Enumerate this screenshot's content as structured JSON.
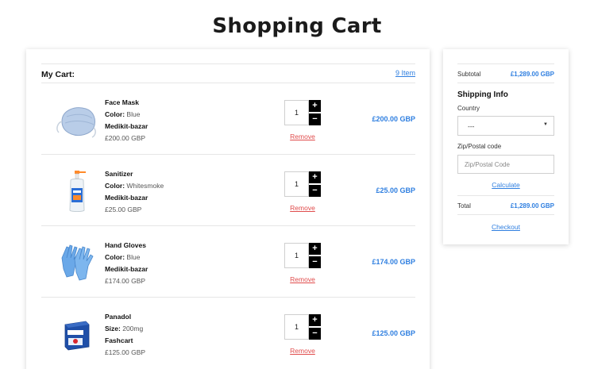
{
  "page": {
    "title": "Shopping Cart"
  },
  "cart": {
    "heading": "My Cart:",
    "item_count": "9 Item",
    "items": [
      {
        "name": "Face Mask",
        "attr_key": "Color:",
        "attr_val": "Blue",
        "brand": "Medikit-bazar",
        "unit_price": "£200.00 GBP",
        "qty": "1",
        "remove": "Remove",
        "line_total": "£200.00 GBP",
        "icon": "face-mask-icon"
      },
      {
        "name": "Sanitizer",
        "attr_key": "Color:",
        "attr_val": "Whitesmoke",
        "brand": "Medikit-bazar",
        "unit_price": "£25.00 GBP",
        "qty": "1",
        "remove": "Remove",
        "line_total": "£25.00 GBP",
        "icon": "sanitizer-bottle-icon"
      },
      {
        "name": "Hand Gloves",
        "attr_key": "Color:",
        "attr_val": "Blue",
        "brand": "Medikit-bazar",
        "unit_price": "£174.00 GBP",
        "qty": "1",
        "remove": "Remove",
        "line_total": "£174.00 GBP",
        "icon": "gloves-icon"
      },
      {
        "name": "Panadol",
        "attr_key": "Size:",
        "attr_val": "200mg",
        "brand": "Fashcart",
        "unit_price": "£125.00 GBP",
        "qty": "1",
        "remove": "Remove",
        "line_total": "£125.00 GBP",
        "icon": "medicine-box-icon"
      }
    ],
    "plus": "+",
    "minus": "−"
  },
  "summary": {
    "subtotal_label": "Subtotal",
    "subtotal_value": "£1,289.00 GBP",
    "shipping_title": "Shipping Info",
    "country_label": "Country",
    "country_value": "---",
    "zip_label": "Zip/Postal code",
    "zip_placeholder": "Zip/Postal Code",
    "calculate": "Calculate",
    "total_label": "Total",
    "total_value": "£1,289.00 GBP",
    "checkout": "Checkout"
  },
  "colors": {
    "accent": "#2f7fe0",
    "danger": "#e04c4c"
  }
}
